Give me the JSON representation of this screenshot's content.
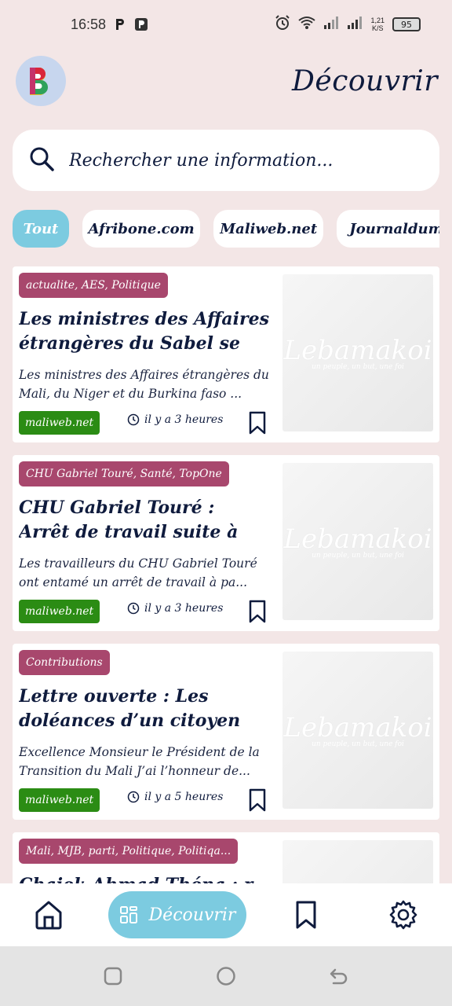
{
  "status_bar": {
    "time": "16:58",
    "battery": "95",
    "speed_value": "1,21",
    "speed_unit": "K/S"
  },
  "header": {
    "title": "Découvrir"
  },
  "search": {
    "placeholder": "Rechercher une information..."
  },
  "filters": [
    "Tout",
    "Afribone.com",
    "Maliweb.net",
    "Journaldumali"
  ],
  "articles": [
    {
      "tags": "actualite, AES, Politique",
      "title": "Les ministres des Affaires étrangères du Sabel se re...",
      "excerpt": "Les ministres des Affaires étrangères du Mali, du Niger et du Burkina faso ...",
      "source": "maliweb.net",
      "time": "il y a 3 heures"
    },
    {
      "tags": "CHU Gabriel Touré, Santé, TopOne",
      "title": "CHU Gabriel Touré : Arrêt de travail suite à une affaire ...",
      "excerpt": "Les travailleurs du CHU Gabriel Touré ont entamé un arrêt de travail à pa...",
      "source": "maliweb.net",
      "time": "il y a 3 heures"
    },
    {
      "tags": "Contributions",
      "title": "Lettre ouverte : Les doléances d’un citoyen au ...",
      "excerpt": "Excellence Monsieur le Président de la Transition du Mali J’ai l’honneur de...",
      "source": "maliweb.net",
      "time": "il y a 5 heures"
    },
    {
      "tags": "Mali, MJB, parti, Politique, Politiqa...",
      "title": "Chaiek Ahmad Théna : r...",
      "excerpt": "",
      "source": "",
      "time": ""
    }
  ],
  "thumb_watermark": {
    "main": "Lebamakoi",
    "sub": "un peuple, un but, une foi"
  },
  "bottom_nav": {
    "discover_label": "Découvrir"
  },
  "colors": {
    "accent": "#7ccbe0",
    "tag": "#a8476d",
    "source": "#2b8c14",
    "text": "#0f1b3d",
    "background": "#f3e6e6"
  }
}
